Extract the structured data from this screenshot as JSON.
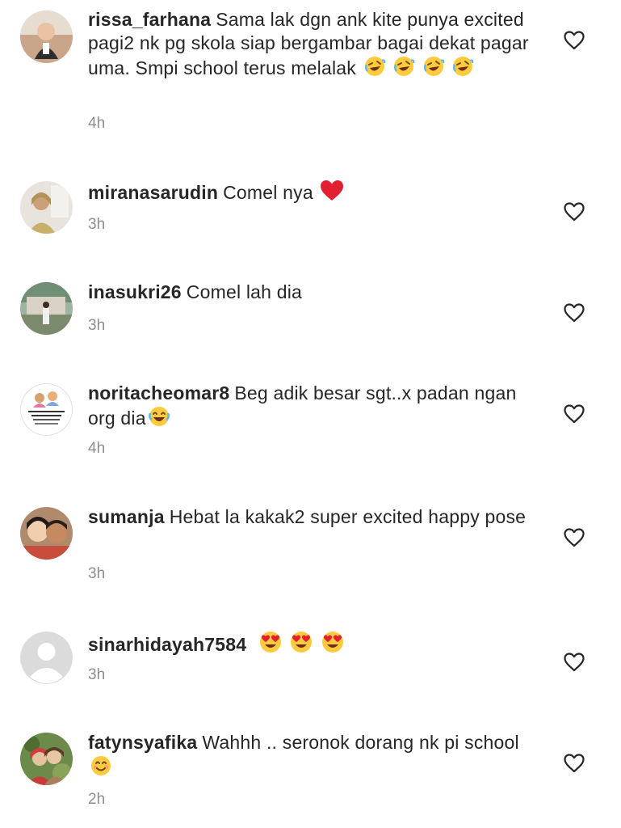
{
  "comments": [
    {
      "username": "rissa_farhana",
      "text": "Sama lak dgn ank kite punya excited pagi2 nk pg skola siap bergambar bagai dekat pagar uma. Smpi school terus melalak",
      "emoji": [
        "rofl",
        "rofl",
        "rofl",
        "rofl"
      ],
      "time": "4h"
    },
    {
      "username": "miranasarudin",
      "text": "Comel nya",
      "emoji": [
        "red-heart"
      ],
      "time": "3h"
    },
    {
      "username": "inasukri26",
      "text": "Comel lah dia",
      "emoji": [],
      "time": "3h"
    },
    {
      "username": "noritacheomar8",
      "text": "Beg adik besar sgt..x padan ngan org dia",
      "emoji": [
        "joy"
      ],
      "time": "4h"
    },
    {
      "username": "sumanja",
      "text": "Hebat la kakak2 super excited happy pose",
      "emoji": [],
      "time": "3h"
    },
    {
      "username": "sinarhidayah7584",
      "text": "",
      "emoji": [
        "heart-eyes",
        "heart-eyes",
        "heart-eyes"
      ],
      "time": "3h"
    },
    {
      "username": "fatynsyafika",
      "text": "Wahhh .. seronok dorang nk pi school",
      "emoji": [
        "smiling"
      ],
      "time": "2h"
    }
  ],
  "icons": {
    "like": "heart-outline-icon"
  },
  "colors": {
    "text": "#262626",
    "secondary": "#8e8e8e",
    "heart_stroke": "#262626"
  }
}
